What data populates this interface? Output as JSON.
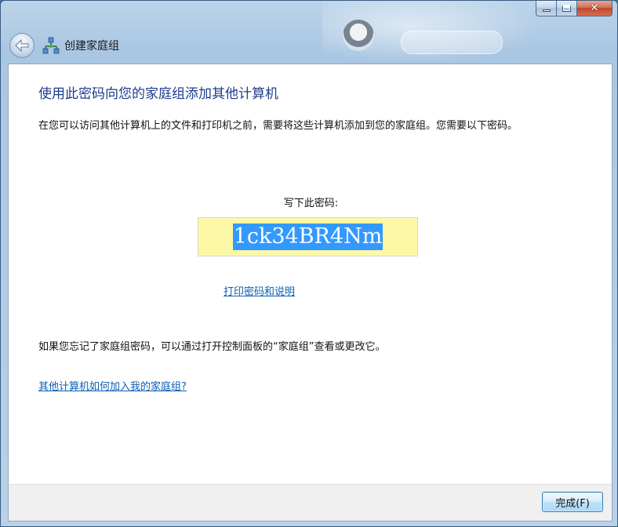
{
  "window": {
    "caption_buttons": {
      "minimize_icon": "minimize-icon",
      "maximize_icon": "maximize-icon",
      "close_icon": "close-icon",
      "close_glyph": "✕"
    }
  },
  "nav": {
    "back_icon": "back-arrow-icon",
    "network_icon": "homegroup-network-icon",
    "title": "创建家庭组"
  },
  "main": {
    "heading": "使用此密码向您的家庭组添加其他计算机",
    "description": "在您可以访问其他计算机上的文件和打印机之前，需要将这些计算机添加到您的家庭组。您需要以下密码。",
    "password_label": "写下此密码:",
    "password": "1ck34BR4Nm",
    "print_link": "打印密码和说明",
    "forgot_text": "如果您忘记了家庭组密码，可以通过打开控制面板的“家庭组”查看或更改它。",
    "join_link": "其他计算机如何加入我的家庭组?"
  },
  "footer": {
    "finish_button": "完成(F)"
  },
  "colors": {
    "heading": "#1e3c8c",
    "link": "#0b5fb5",
    "password_box": "#fdf8a5",
    "selection": "#3399ff"
  }
}
